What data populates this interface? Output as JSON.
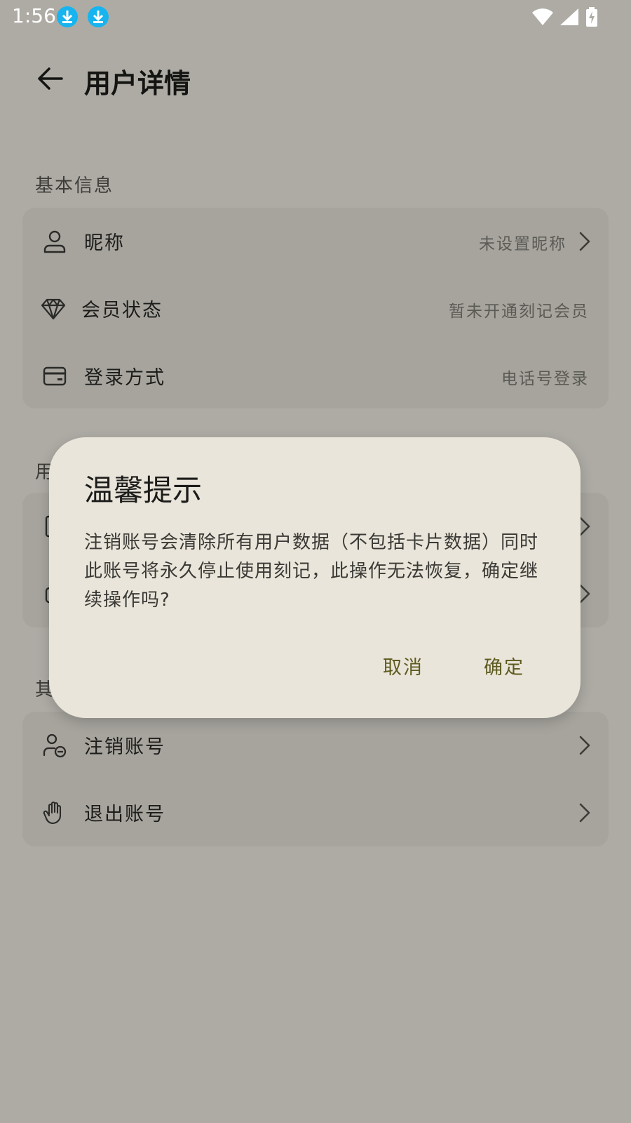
{
  "status_bar": {
    "time": "1:56"
  },
  "header": {
    "title": "用户详情"
  },
  "sections": [
    {
      "label": "基本信息",
      "rows": [
        {
          "icon": "person-icon",
          "label": "昵称",
          "value": "未设置昵称",
          "chevron": true
        },
        {
          "icon": "diamond-icon",
          "label": "会员状态",
          "value": "暂未开通刻记会员",
          "chevron": false
        },
        {
          "icon": "card-icon",
          "label": "登录方式",
          "value": "电话号登录",
          "chevron": false
        }
      ]
    },
    {
      "label": "用"
    },
    {
      "label": "其",
      "rows": [
        {
          "icon": "user-remove-icon",
          "label": "注销账号",
          "chevron": true
        },
        {
          "icon": "wave-hand-icon",
          "label": "退出账号",
          "chevron": true
        }
      ]
    }
  ],
  "dialog": {
    "title": "温馨提示",
    "message": "注销账号会清除所有用户数据（不包括卡片数据）同时此账号将永久停止使用刻记，此操作无法恢复，确定继续操作吗?",
    "cancel_label": "取消",
    "confirm_label": "确定"
  },
  "colors": {
    "background": "#adaba4",
    "card": "#a6a49d",
    "dialog": "#e9e5da",
    "dialog_button": "#5d5a1f",
    "download_badge": "#17b4ef"
  }
}
